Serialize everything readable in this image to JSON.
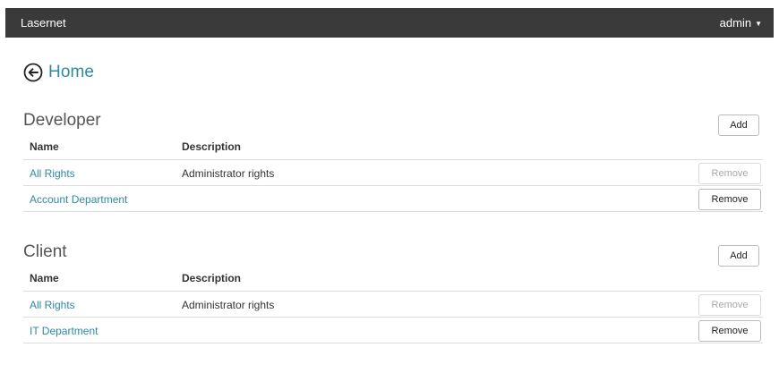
{
  "header": {
    "brand": "Lasernet",
    "user": "admin"
  },
  "home": {
    "label": "Home",
    "icon": "arrow-left-circle-icon"
  },
  "sections": [
    {
      "title": "Developer",
      "add_label": "Add",
      "columns": {
        "name": "Name",
        "description": "Description"
      },
      "rows": [
        {
          "name": "All Rights",
          "description": "Administrator rights",
          "action": "Remove",
          "action_enabled": false
        },
        {
          "name": "Account Department",
          "description": "",
          "action": "Remove",
          "action_enabled": true
        }
      ]
    },
    {
      "title": "Client",
      "add_label": "Add",
      "columns": {
        "name": "Name",
        "description": "Description"
      },
      "rows": [
        {
          "name": "All Rights",
          "description": "Administrator rights",
          "action": "Remove",
          "action_enabled": false
        },
        {
          "name": "IT Department",
          "description": "",
          "action": "Remove",
          "action_enabled": true
        }
      ]
    }
  ],
  "colors": {
    "topbar": "#3a3a3a",
    "link": "#2f8aa0",
    "divider": "#dddddd"
  }
}
